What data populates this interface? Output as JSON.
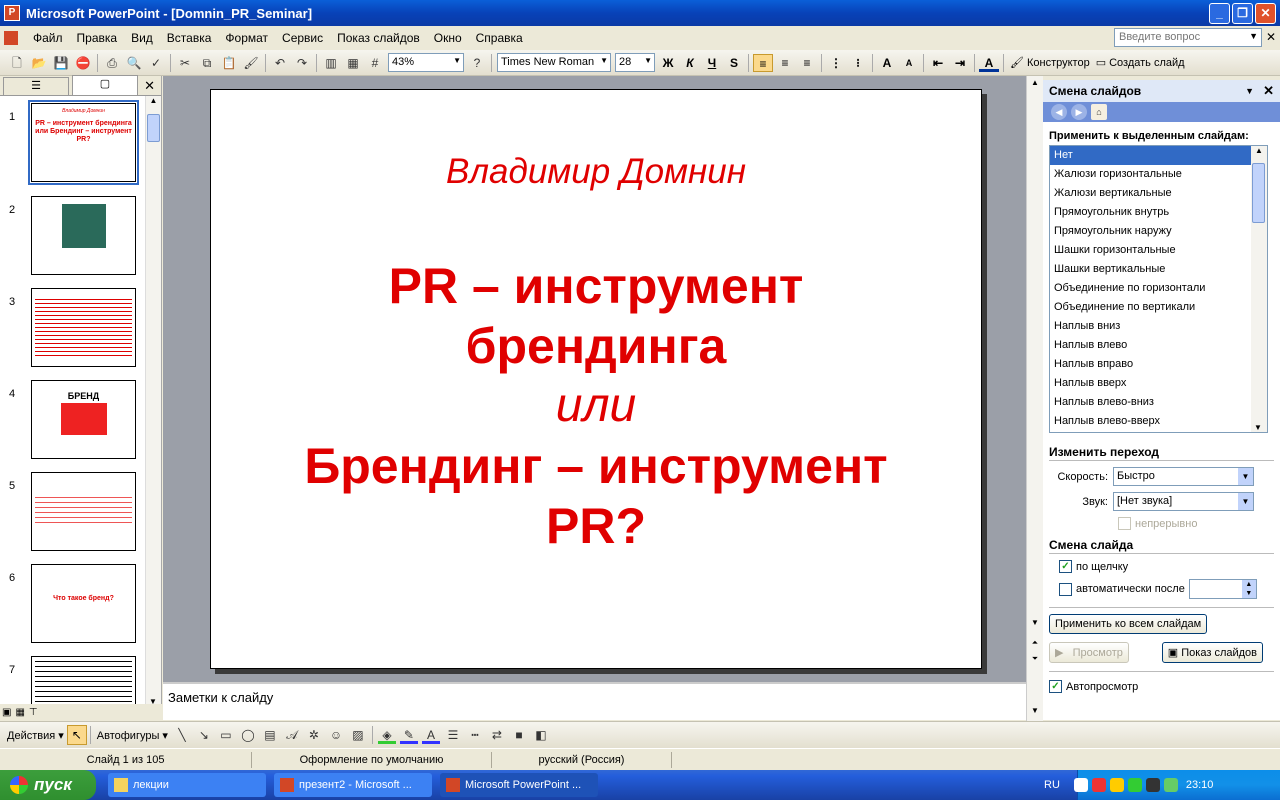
{
  "window": {
    "title": "Microsoft PowerPoint - [Domnin_PR_Seminar]",
    "app_icon": "powerpoint-icon"
  },
  "menu": {
    "items": [
      "Файл",
      "Правка",
      "Вид",
      "Вставка",
      "Формат",
      "Сервис",
      "Показ слайдов",
      "Окно",
      "Справка"
    ],
    "ask_placeholder": "Введите вопрос"
  },
  "toolbar": {
    "zoom": "43%",
    "font": "Times New Roman",
    "size": "28",
    "bold": "Ж",
    "italic": "К",
    "underline": "Ч",
    "shadow": "S",
    "designer": "Конструктор",
    "new_slide": "Создать слайд"
  },
  "thumbnails": [
    {
      "num": "1",
      "title": "Владимир Домнин",
      "body": "PR – инструмент брендинга или Брендинг – инструмент PR?"
    },
    {
      "num": "2",
      "title": "",
      "body": ""
    },
    {
      "num": "3",
      "title": "",
      "body": ""
    },
    {
      "num": "4",
      "title": "",
      "body": "БРЕНД"
    },
    {
      "num": "5",
      "title": "",
      "body": ""
    },
    {
      "num": "6",
      "title": "",
      "body": "Что такое бренд?"
    },
    {
      "num": "7",
      "title": "",
      "body": ""
    }
  ],
  "slide": {
    "author": "Владимир Домнин",
    "line1": "PR – инструмент",
    "line2": "брендинга",
    "line3": "или",
    "line4": "Брендинг – инструмент",
    "line5": "PR?"
  },
  "notes": "Заметки к слайду",
  "taskpane": {
    "title": "Смена слайдов",
    "apply_label": "Применить к выделенным слайдам:",
    "transitions": [
      "Нет",
      "Жалюзи горизонтальные",
      "Жалюзи вертикальные",
      "Прямоугольник внутрь",
      "Прямоугольник наружу",
      "Шашки горизонтальные",
      "Шашки вертикальные",
      "Объединение по горизонтали",
      "Объединение по вертикали",
      "Наплыв вниз",
      "Наплыв влево",
      "Наплыв вправо",
      "Наплыв вверх",
      "Наплыв влево-вниз",
      "Наплыв влево-вверх"
    ],
    "modify_header": "Изменить переход",
    "speed_label": "Скорость:",
    "speed_value": "Быстро",
    "sound_label": "Звук:",
    "sound_value": "[Нет звука]",
    "loop_label": "непрерывно",
    "advance_header": "Смена слайда",
    "on_click_label": "по щелчку",
    "auto_label": "автоматически после",
    "apply_all": "Применить ко всем слайдам",
    "preview": "Просмотр",
    "slideshow": "Показ слайдов",
    "autopreview": "Автопросмотр"
  },
  "drawbar": {
    "actions": "Действия",
    "autoshapes": "Автофигуры"
  },
  "status": {
    "slide": "Слайд 1 из 105",
    "design": "Оформление по умолчанию",
    "lang": "русский (Россия)"
  },
  "taskbar": {
    "start": "пуск",
    "tasks": [
      "лекции",
      "презент2 - Microsoft ...",
      "Microsoft PowerPoint ..."
    ],
    "lang": "RU",
    "clock": "23:10"
  }
}
